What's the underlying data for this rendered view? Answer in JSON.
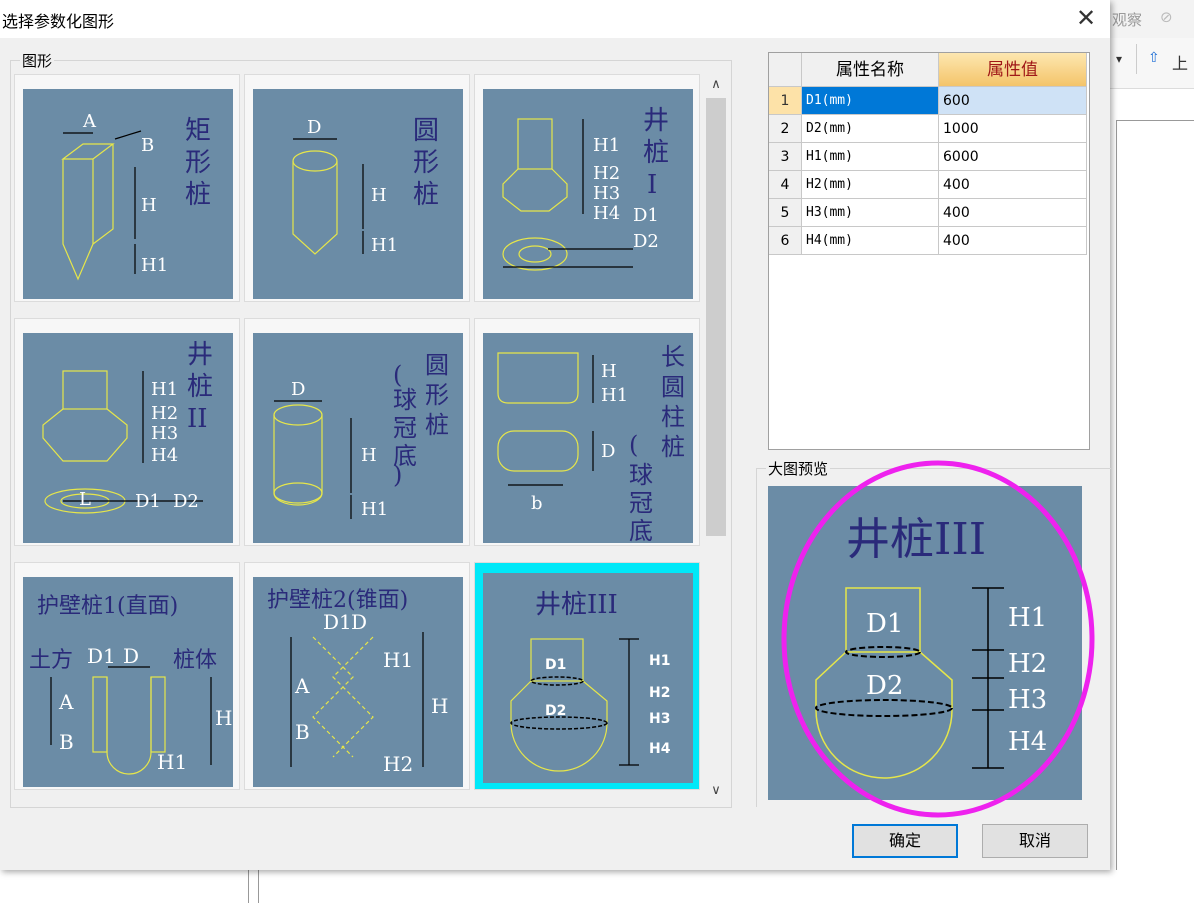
{
  "background_app": {
    "toolbar_text_1": "观察",
    "toolbar_text_2": "上"
  },
  "dialog": {
    "title": "选择参数化图形",
    "close_glyph": "✕"
  },
  "shapes_group": {
    "label": "图形",
    "items": [
      {
        "name": "矩形桩",
        "dims": [
          "A",
          "B",
          "H",
          "H1"
        ]
      },
      {
        "name": "圆形桩",
        "dims": [
          "D",
          "H",
          "H1"
        ]
      },
      {
        "name": "井桩I",
        "dims": [
          "H1",
          "H2",
          "H3",
          "H4",
          "D1",
          "D2"
        ]
      },
      {
        "name": "井桩II",
        "dims": [
          "H1",
          "H2",
          "H3",
          "H4",
          "L",
          "D1",
          "D2"
        ]
      },
      {
        "name": "圆形桩(球冠底)",
        "dims": [
          "D",
          "H",
          "H1"
        ]
      },
      {
        "name": "长圆柱桩(球冠底)",
        "dims": [
          "H",
          "H1",
          "D",
          "b"
        ]
      },
      {
        "name": "护壁桩1(直面)",
        "dims": [
          "土方",
          "D1",
          "D",
          "桩体",
          "A",
          "B",
          "H",
          "H1"
        ]
      },
      {
        "name": "护壁桩2(锥面)",
        "dims": [
          "D1",
          "D",
          "A",
          "B",
          "H1",
          "H",
          "H2"
        ]
      },
      {
        "name": "井桩III",
        "dims": [
          "D1",
          "D2",
          "H1",
          "H2",
          "H3",
          "H4"
        ]
      }
    ],
    "selected_index": 8
  },
  "scrollbar": {
    "up": "∧",
    "down": "∨"
  },
  "property_table": {
    "headers": {
      "index": "",
      "name": "属性名称",
      "value": "属性值"
    },
    "rows": [
      {
        "index": "1",
        "name": "D1(mm)",
        "value": "600"
      },
      {
        "index": "2",
        "name": "D2(mm)",
        "value": "1000"
      },
      {
        "index": "3",
        "name": "H1(mm)",
        "value": "6000"
      },
      {
        "index": "4",
        "name": "H2(mm)",
        "value": "400"
      },
      {
        "index": "5",
        "name": "H3(mm)",
        "value": "400"
      },
      {
        "index": "6",
        "name": "H4(mm)",
        "value": "400"
      }
    ],
    "selected_row": 0
  },
  "preview": {
    "label": "大图预览",
    "title": "井桩III",
    "dims": [
      "D1",
      "D2",
      "H1",
      "H2",
      "H3",
      "H4"
    ]
  },
  "buttons": {
    "ok": "确定",
    "cancel": "取消"
  },
  "colors": {
    "thumb_bg": "#6b8ca6",
    "drawing": "#e6e64a",
    "label": "#2a2a7a",
    "selected_border": "#00e8f8",
    "annotation": "#ee22ee"
  }
}
